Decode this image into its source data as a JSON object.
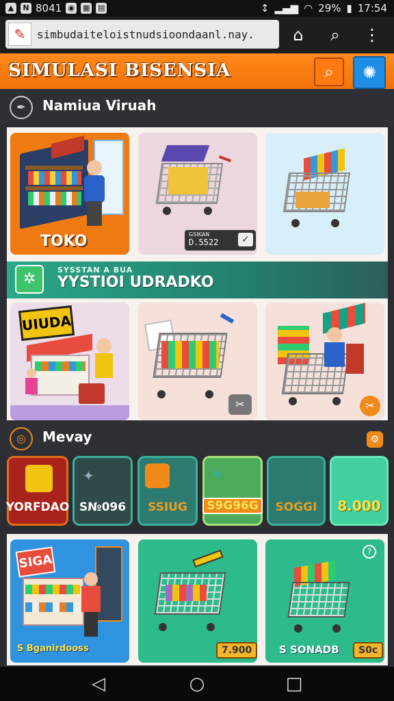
{
  "status": {
    "left_icons": [
      "N",
      "8041"
    ],
    "time": "17:54",
    "battery": "29%"
  },
  "browser": {
    "url": "simbudaiteloistnudsioondaanl.nay."
  },
  "header": {
    "title": "SIMULASI BISENSIA"
  },
  "section1": {
    "title": "Namiua Viruah"
  },
  "section1_cards": {
    "toko_label": "TOKO",
    "price_top": "GSIKAN",
    "price_value": "D.5522"
  },
  "banner": {
    "subtitle": "SYSSTAN A BUA",
    "title": "YYSTIOI UDRADKO"
  },
  "store_sign": "UIUDA",
  "section2": {
    "title": "Mevay"
  },
  "money_tiles": [
    {
      "label": "YORFDAO",
      "bg": "#a9231d",
      "border": "#e36e1a",
      "color": "#ffffff"
    },
    {
      "label": "S№096",
      "bg": "#2f4a48",
      "border": "#3bb09a",
      "color": "#ffffff"
    },
    {
      "label": "SSIUG",
      "bg": "#2d7a70",
      "border": "#3bb09a",
      "color": "#f0a020"
    },
    {
      "label": "S9G96G",
      "bg": "#4caa5c",
      "border": "#a8e07a",
      "color": "#f7e35a"
    },
    {
      "label": "SOGGI",
      "bg": "#2d7a70",
      "border": "#3bb09a",
      "color": "#e8a020"
    },
    {
      "label": "8.000",
      "bg": "#41d1a0",
      "border": "#6ce8ba",
      "color": "#f9e34a"
    }
  ],
  "bottom_cards": {
    "store_sign": "SIGA",
    "store_caption": "S Bganirdooss",
    "cart_price": "7.900",
    "right_caption": "S SONADB",
    "right_price": "S0c"
  },
  "colors": {
    "orange": "#f57c12",
    "teal": "#2ba887",
    "blue": "#1f8de6"
  }
}
